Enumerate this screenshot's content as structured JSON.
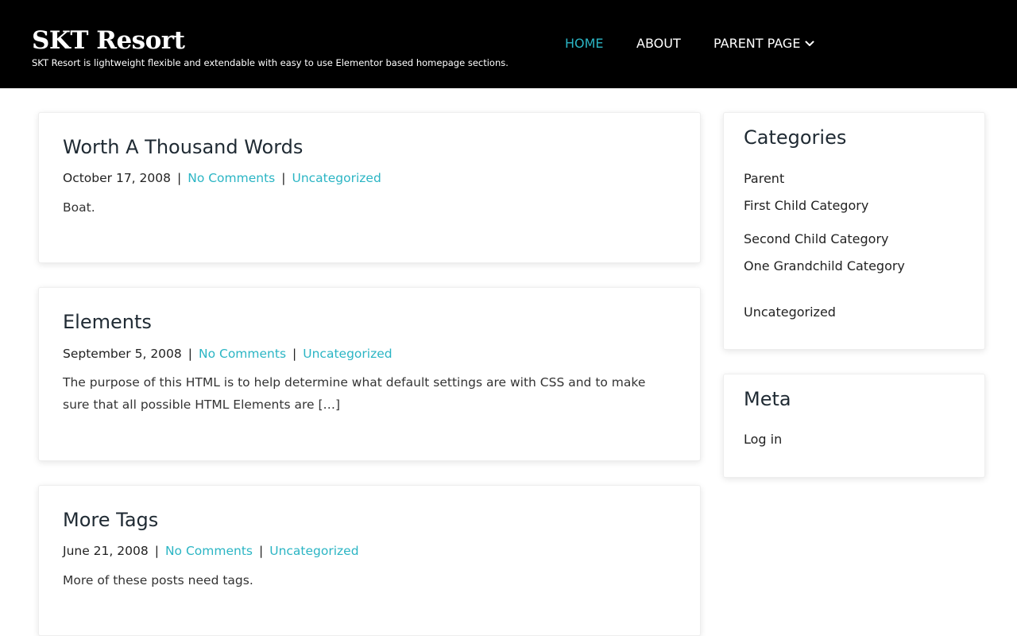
{
  "header": {
    "site_title": "SKT Resort",
    "tagline": "SKT Resort is lightweight flexible and extendable with easy to use Elementor based homepage sections.",
    "nav": [
      {
        "label": "HOME",
        "active": true
      },
      {
        "label": "ABOUT",
        "active": false
      },
      {
        "label": "PARENT PAGE",
        "active": false,
        "icon": "chevron-down-icon"
      }
    ]
  },
  "posts": [
    {
      "title": "Worth A Thousand Words",
      "date": "October 17, 2008",
      "comments": "No Comments",
      "category": "Uncategorized",
      "excerpt": "Boat."
    },
    {
      "title": "Elements",
      "date": "September 5, 2008",
      "comments": "No Comments",
      "category": "Uncategorized",
      "excerpt": "The purpose of this HTML is to help determine what default settings are with CSS and to make sure that all possible HTML Elements are […]"
    },
    {
      "title": "More Tags",
      "date": "June 21, 2008",
      "comments": "No Comments",
      "category": "Uncategorized",
      "excerpt": "More of these posts need tags."
    }
  ],
  "meta_separator": "|",
  "sidebar": {
    "categories": {
      "title": "Categories",
      "items": [
        "Parent",
        "First Child Category",
        "Second Child Category",
        "One Grandchild Category",
        "Uncategorized"
      ]
    },
    "meta": {
      "title": "Meta",
      "items": [
        "Log in"
      ]
    }
  },
  "colors": {
    "header_bg": "#000000",
    "accent": "#2bb5c4",
    "text": "#222222"
  }
}
